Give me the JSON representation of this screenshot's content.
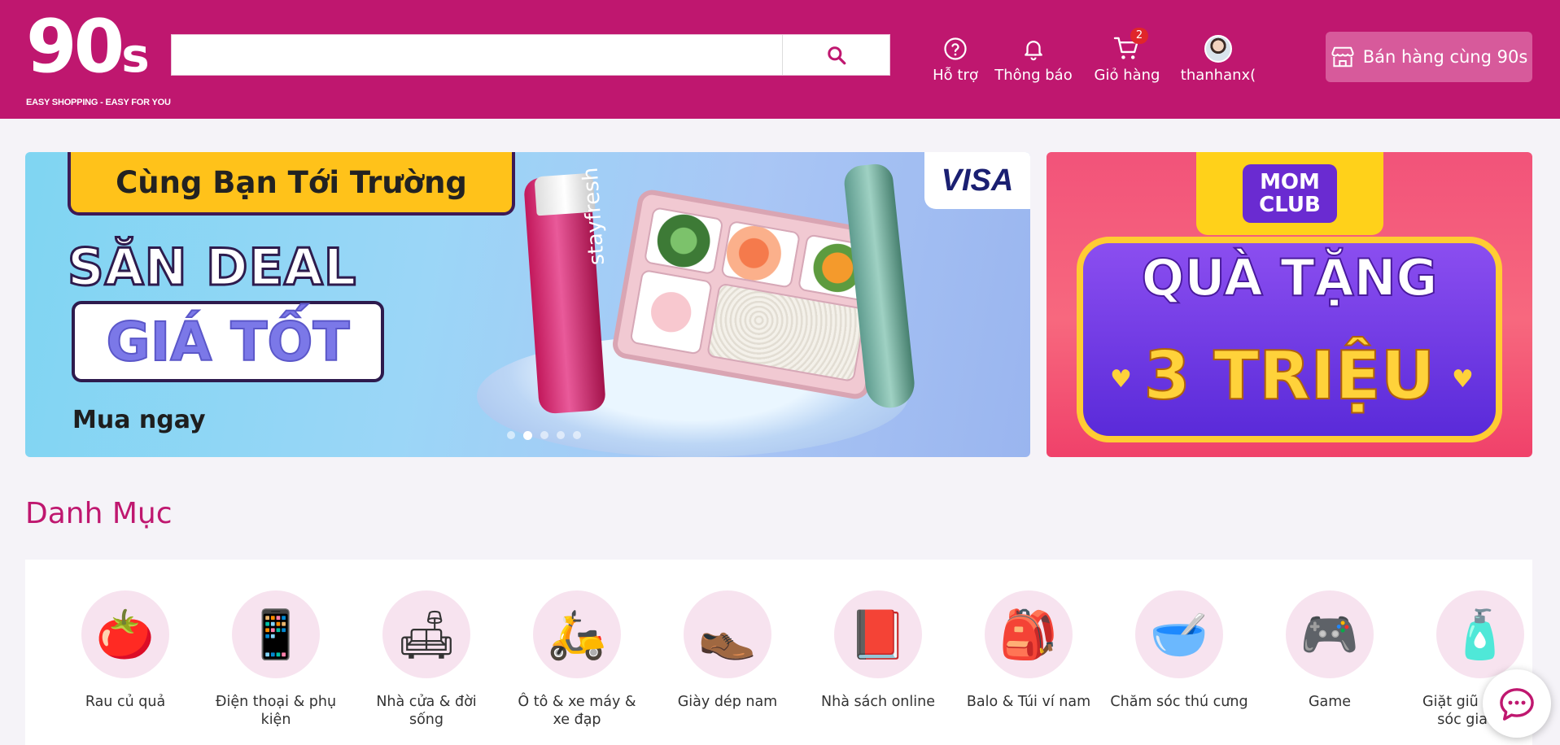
{
  "header": {
    "logo": {
      "main": "90",
      "suffix": "s",
      "tagline": "EASY SHOPPING - EASY FOR YOU"
    },
    "search": {
      "value": "",
      "placeholder": "",
      "icon": "search-icon"
    },
    "nav": [
      {
        "label": "Hỗ trợ",
        "icon": "help-circle-icon"
      },
      {
        "label": "Thông báo",
        "icon": "bell-icon"
      },
      {
        "label": "Giỏ hàng",
        "icon": "cart-icon",
        "badge": "2"
      },
      {
        "label": "thanhanx(",
        "icon": "avatar"
      }
    ],
    "sell_button": {
      "label": "Bán hàng cùng 90s",
      "icon": "store-icon"
    }
  },
  "banners": {
    "main": {
      "title": "Cùng Bạn Tới Trường",
      "headline": "SĂN DEAL",
      "highlight": "GIÁ TỐT",
      "cta": "Mua ngay",
      "bottle_text": "stayfresh",
      "partner": "VISA",
      "slide_index": 2,
      "slide_count": 5
    },
    "side": {
      "badge": "MOM CLUB",
      "line1": "QUÀ TẶNG",
      "line2": "3 TRIỆU"
    }
  },
  "categories": {
    "title": "Danh Mục",
    "items": [
      {
        "label": "Rau củ quả",
        "icon": "🍅"
      },
      {
        "label": "Điện thoại & phụ kiện",
        "icon": "📱"
      },
      {
        "label": "Nhà cửa & đời sống",
        "icon": "🛋"
      },
      {
        "label": "Ô tô & xe máy & xe đạp",
        "icon": "🛵"
      },
      {
        "label": "Giày dép nam",
        "icon": "👞"
      },
      {
        "label": "Nhà sách online",
        "icon": "📕"
      },
      {
        "label": "Balo & Túi ví nam",
        "icon": "🎒"
      },
      {
        "label": "Chăm sóc thú cưng",
        "icon": "🥣"
      },
      {
        "label": "Game",
        "icon": "🎮"
      },
      {
        "label": "Giặt giũ & chăm sóc gia đình",
        "icon": "🧴"
      }
    ]
  },
  "chat": {
    "icon": "chat-bubble-icon"
  },
  "colors": {
    "brand": "#bf176f",
    "sell_button": "#d75a9b",
    "badge": "#e0262a"
  }
}
